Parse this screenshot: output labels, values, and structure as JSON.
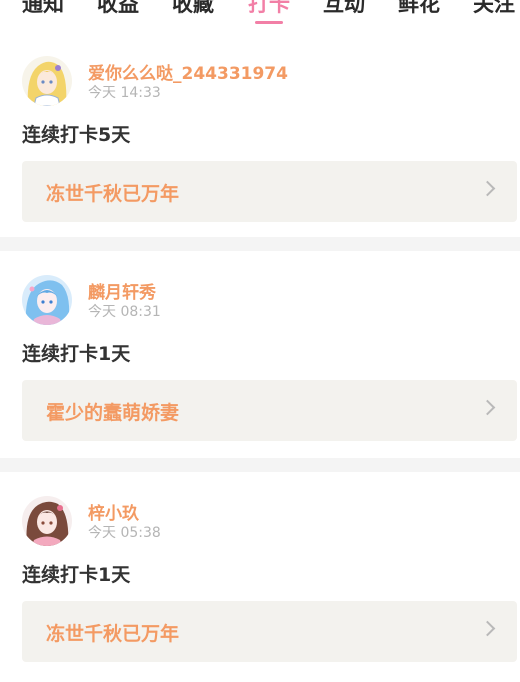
{
  "tabs": [
    {
      "label": "通知",
      "active": false
    },
    {
      "label": "收益",
      "active": false
    },
    {
      "label": "收藏",
      "active": false
    },
    {
      "label": "打卡",
      "active": true
    },
    {
      "label": "互动",
      "active": false
    },
    {
      "label": "鲜花",
      "active": false
    },
    {
      "label": "关注",
      "active": false
    }
  ],
  "feed": [
    {
      "username": "爱你么么哒_244331974",
      "time": "今天 14:33",
      "checkin": "连续打卡5天",
      "book": "冻世千秋已万年"
    },
    {
      "username": "麟月轩秀",
      "time": "今天 08:31",
      "checkin": "连续打卡1天",
      "book": "霍少的蠢萌娇妻"
    },
    {
      "username": "梓小玖",
      "time": "今天 05:38",
      "checkin": "连续打卡1天",
      "book": "冻世千秋已万年"
    }
  ],
  "colors": {
    "accent_pink": "#f27fa6",
    "accent_orange": "#f39a63",
    "card_bg": "#f3f2ee"
  }
}
